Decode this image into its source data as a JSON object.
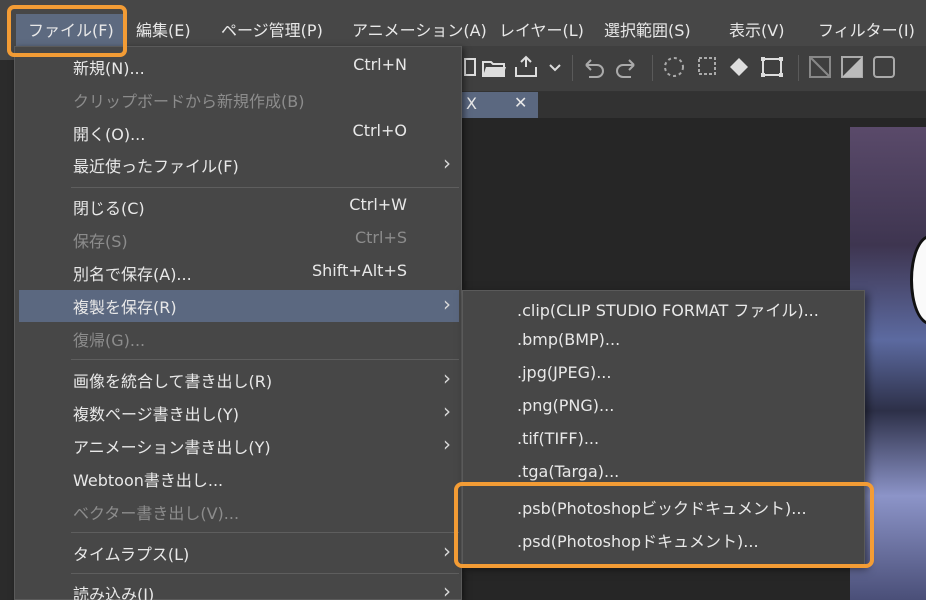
{
  "menubar": {
    "items": [
      {
        "label": "ファイル(F)"
      },
      {
        "label": "編集(E)"
      },
      {
        "label": "ページ管理(P)"
      },
      {
        "label": "アニメーション(A)"
      },
      {
        "label": "レイヤー(L)"
      },
      {
        "label": "選択範囲(S)"
      },
      {
        "label": "表示(V)"
      },
      {
        "label": "フィルター(I)"
      }
    ]
  },
  "toolbar": {
    "icons": [
      "save-icon",
      "open-folder-icon",
      "export-icon",
      "undo-icon",
      "redo-icon",
      "lasso-select-icon",
      "select-all-icon",
      "fill-icon",
      "transform-icon",
      "clear-icon",
      "fill-selection-icon",
      "frame-icon"
    ]
  },
  "tab": {
    "title": "X",
    "close": "✕"
  },
  "file_menu": {
    "new": {
      "label": "新規(N)...",
      "shortcut": "Ctrl+N"
    },
    "new_from_clipboard": {
      "label": "クリップボードから新規作成(B)"
    },
    "open": {
      "label": "開く(O)...",
      "shortcut": "Ctrl+O"
    },
    "recent": {
      "label": "最近使ったファイル(F)"
    },
    "close": {
      "label": "閉じる(C)",
      "shortcut": "Ctrl+W"
    },
    "save": {
      "label": "保存(S)",
      "shortcut": "Ctrl+S"
    },
    "save_as": {
      "label": "別名で保存(A)...",
      "shortcut": "Shift+Alt+S"
    },
    "save_copy": {
      "label": "複製を保存(R)"
    },
    "revert": {
      "label": "復帰(G)..."
    },
    "export_merged": {
      "label": "画像を統合して書き出し(R)"
    },
    "export_multiple": {
      "label": "複数ページ書き出し(Y)"
    },
    "export_animation": {
      "label": "アニメーション書き出し(Y)"
    },
    "export_webtoon": {
      "label": "Webtoon書き出し..."
    },
    "export_vector": {
      "label": "ベクター書き出し(V)..."
    },
    "timelapse": {
      "label": "タイムラプス(L)"
    },
    "import": {
      "label": "読み込み(I)"
    },
    "arrow": "›"
  },
  "save_copy_submenu": {
    "items": [
      {
        "label": ".clip(CLIP STUDIO FORMAT ファイル)..."
      },
      {
        "label": ".bmp(BMP)..."
      },
      {
        "label": ".jpg(JPEG)..."
      },
      {
        "label": ".png(PNG)..."
      },
      {
        "label": ".tif(TIFF)..."
      },
      {
        "label": ".tga(Targa)..."
      },
      {
        "label": ".psb(Photoshopビックドキュメント)..."
      },
      {
        "label": ".psd(Photoshopドキュメント)..."
      }
    ]
  },
  "colors": {
    "highlight": "#5b6880",
    "annotation": "#f39c35",
    "menu_bg": "#474747"
  }
}
